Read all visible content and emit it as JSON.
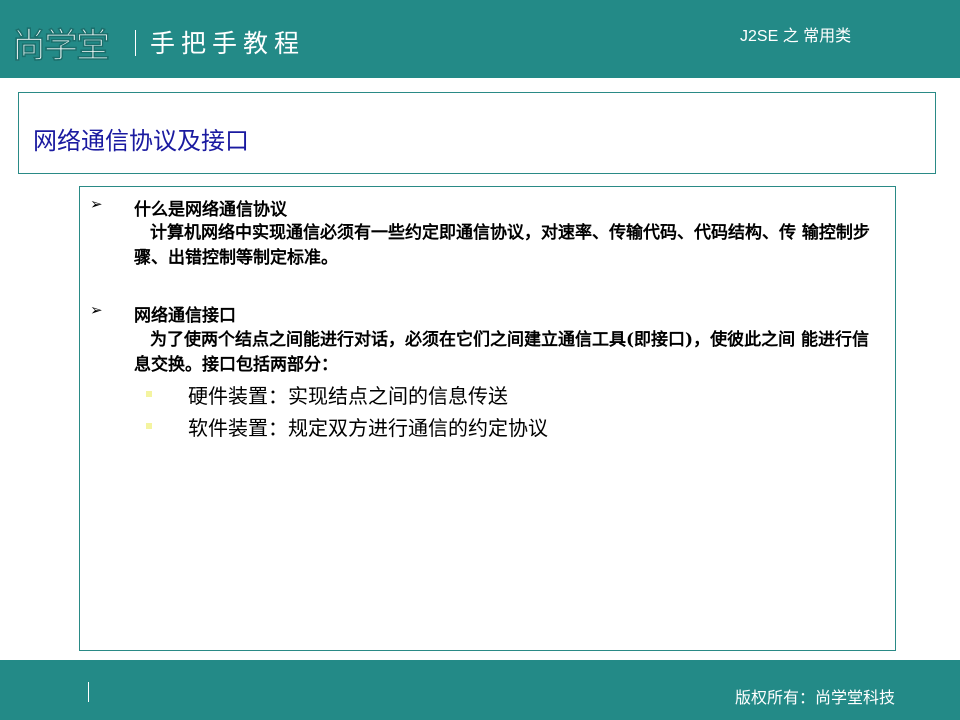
{
  "header": {
    "logo": "尚学堂",
    "tagline": "手把手教程",
    "course": "J2SE 之 常用类"
  },
  "slide": {
    "title": "网络通信协议及接口",
    "sections": [
      {
        "heading": "什么是网络通信协议",
        "text": "计算机网络中实现通信必须有一些约定即通信协议，对速率、传输代码、代码结构、传 输控制步骤、出错控制等制定标准。"
      },
      {
        "heading": "网络通信接口",
        "text": "为了使两个结点之间能进行对话，必须在它们之间建立通信工具(即接口)，使彼此之间 能进行信息交换。接口包括两部分：",
        "items": [
          "硬件装置：实现结点之间的信息传送",
          "软件装置：规定双方进行通信的约定协议"
        ]
      }
    ]
  },
  "footer": {
    "copyright": "版权所有：尚学堂科技"
  },
  "colors": {
    "bar": "#238a87",
    "title": "#1a1aa0"
  }
}
